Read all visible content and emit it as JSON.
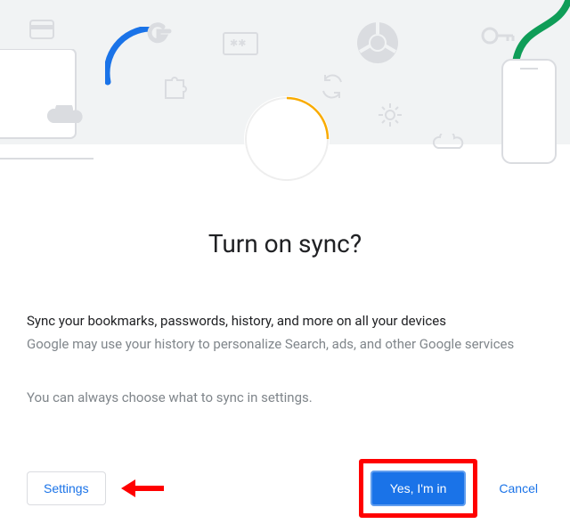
{
  "dialog": {
    "title": "Turn on sync?",
    "desc_primary": "Sync your bookmarks, passwords, history, and more on all your devices",
    "desc_secondary": "Google may use your history to personalize Search, ads, and other Google services",
    "note": "You can always choose what to sync in settings."
  },
  "buttons": {
    "settings": "Settings",
    "confirm": "Yes, I'm in",
    "cancel": "Cancel"
  },
  "icons": {
    "card": "card-icon",
    "g_logo": "google-g-icon",
    "password": "password-icon",
    "chrome": "chrome-icon",
    "key": "key-icon",
    "puzzle": "puzzle-icon",
    "sync": "sync-icon",
    "gear": "gear-icon",
    "cloud_left": "cloud-icon",
    "cloud_right": "cloud-icon",
    "phone": "phone-icon",
    "green_line": "decorative-line",
    "blue_arc": "decorative-arc"
  },
  "colors": {
    "primary": "#1a73e8",
    "highlight": "#ff0000",
    "green": "#0f9d58",
    "amber": "#f9ab00",
    "grey_bg": "#f1f3f4",
    "icon_stroke": "#dadce0"
  }
}
